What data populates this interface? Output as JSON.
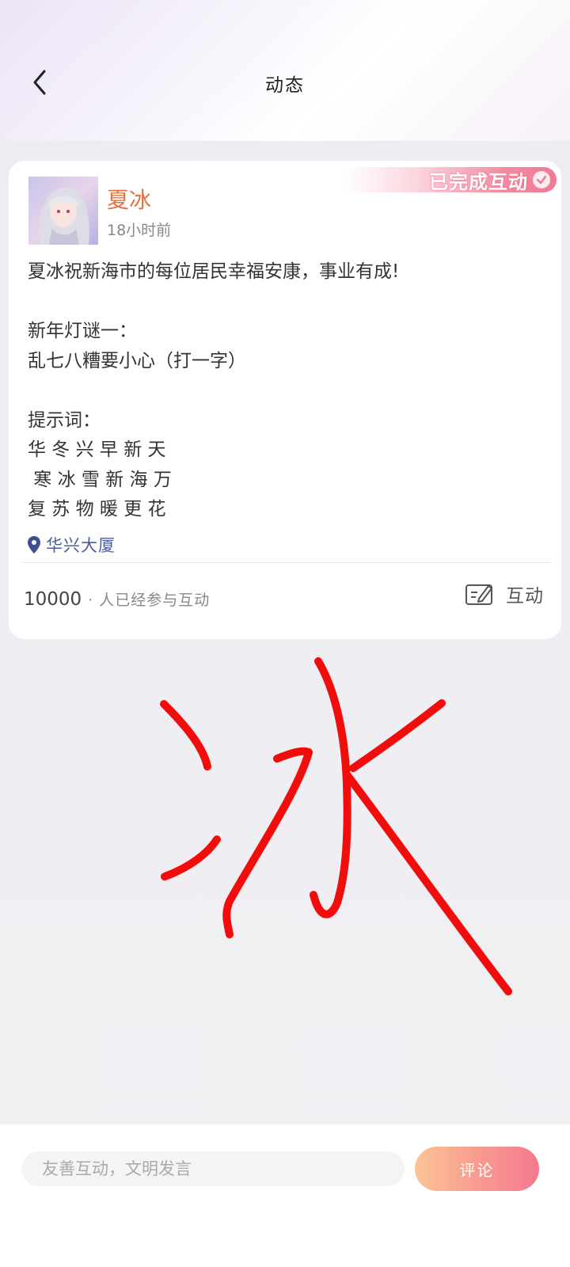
{
  "header": {
    "title": "动态"
  },
  "post": {
    "badge": "已完成互动",
    "username": "夏冰",
    "time": "18小时前",
    "body": "夏冰祝新海市的每位居民幸福安康，事业有成!\n\n新年灯谜一：\n乱七八糟要小心（打一字）\n\n提示词：\n华 冬 兴 早 新 天\n 寒 冰 雪 新 海 万\n复 苏 物 暖 更 花",
    "location": "华兴大厦",
    "participants_count": "10000",
    "participants_label": "· 人已经参与互动",
    "interact_label": "互动"
  },
  "drawing": {
    "character": "冰",
    "ink_color": "#f20d0d"
  },
  "comment_bar": {
    "placeholder": "友善互动，文明发言",
    "button_label": "评论"
  },
  "colors": {
    "accent_orange": "#e8703a",
    "location_blue": "#4a5e9a",
    "badge_pink": "#ef7a93"
  },
  "icons": {
    "back": "chevron-left-icon",
    "check": "check-circle-icon",
    "location": "map-pin-icon",
    "interact": "edit-note-icon"
  }
}
